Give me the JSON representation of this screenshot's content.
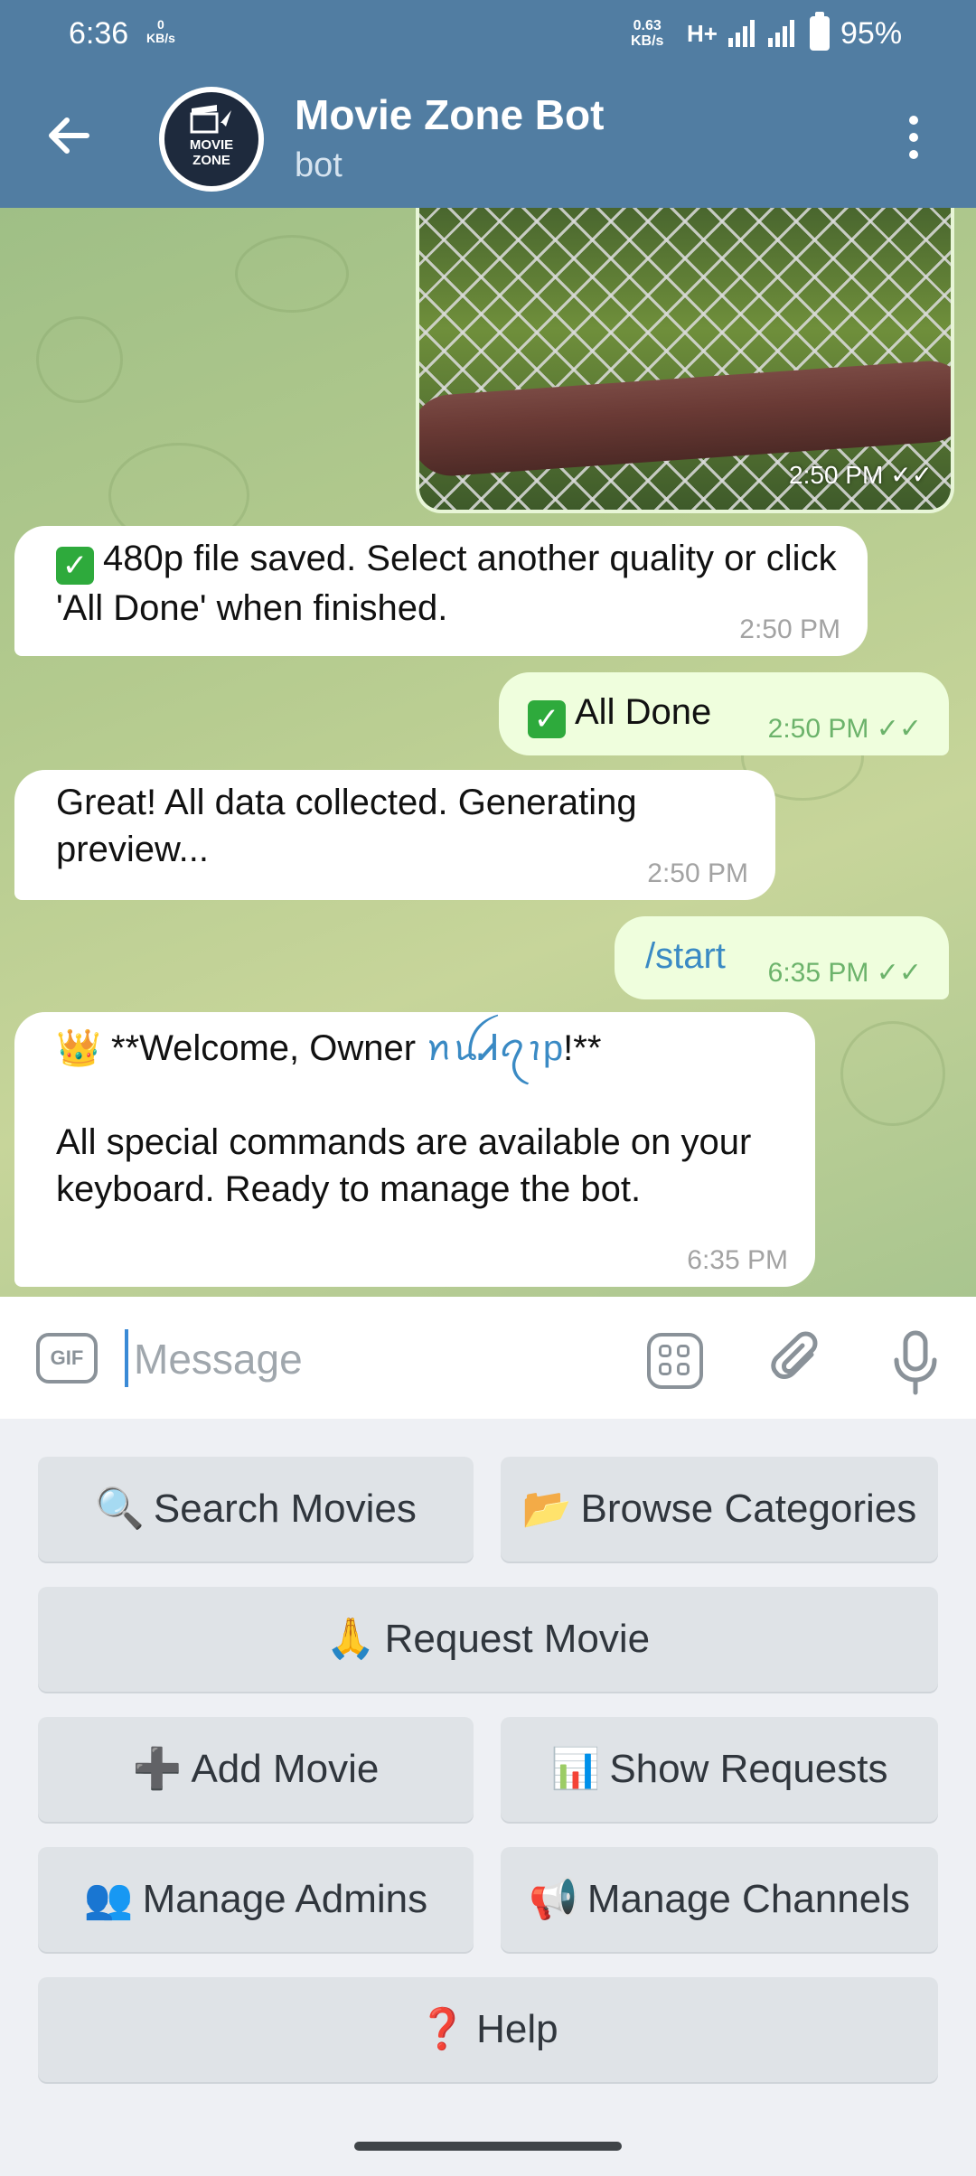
{
  "status_bar": {
    "time": "6:36",
    "speed_left_value": "0",
    "speed_left_unit": "KB/s",
    "speed_right_value": "0.63",
    "speed_right_unit": "KB/s",
    "network": "H+",
    "battery": "95%"
  },
  "header": {
    "title": "Movie Zone Bot",
    "subtitle": "bot",
    "avatar_line1": "MOVIE",
    "avatar_line2": "ZONE"
  },
  "messages": {
    "photo_time": "2:50 PM",
    "m1_text": "480p file saved. Select another quality or click 'All Done' when finished.",
    "m1_time": "2:50 PM",
    "m2_text": "All Done",
    "m2_time": "2:50 PM",
    "m3_text": "Great! All data collected. Generating preview...",
    "m3_time": "2:50 PM",
    "m4_text": "/start",
    "m4_time": "6:35 PM",
    "m5_prefix": "**Welcome, Owner ",
    "m5_handle": "ꪀꪊᏗꪖꪱp",
    "m5_suffix": "!**",
    "m5_body": "All special commands are available on your keyboard. Ready to manage the bot.",
    "m5_time": "6:35 PM"
  },
  "composer": {
    "placeholder": "Message",
    "gif_label": "GIF"
  },
  "keyboard": {
    "search": {
      "icon": "🔍",
      "label": "Search Movies"
    },
    "browse": {
      "icon": "📂",
      "label": "Browse Categories"
    },
    "request": {
      "icon": "🙏",
      "label": "Request Movie"
    },
    "add": {
      "icon": "➕",
      "label": "Add Movie"
    },
    "show": {
      "icon": "📊",
      "label": "Show Requests"
    },
    "admins": {
      "icon": "👥",
      "label": "Manage Admins"
    },
    "channels": {
      "icon": "📢",
      "label": "Manage Channels"
    },
    "help": {
      "icon": "❓",
      "label": "Help"
    }
  },
  "colors": {
    "header": "#517da2",
    "outgoing_bubble": "#effedd",
    "keyboard_button": "#dfe3e7",
    "read_check": "#6cb36b"
  }
}
